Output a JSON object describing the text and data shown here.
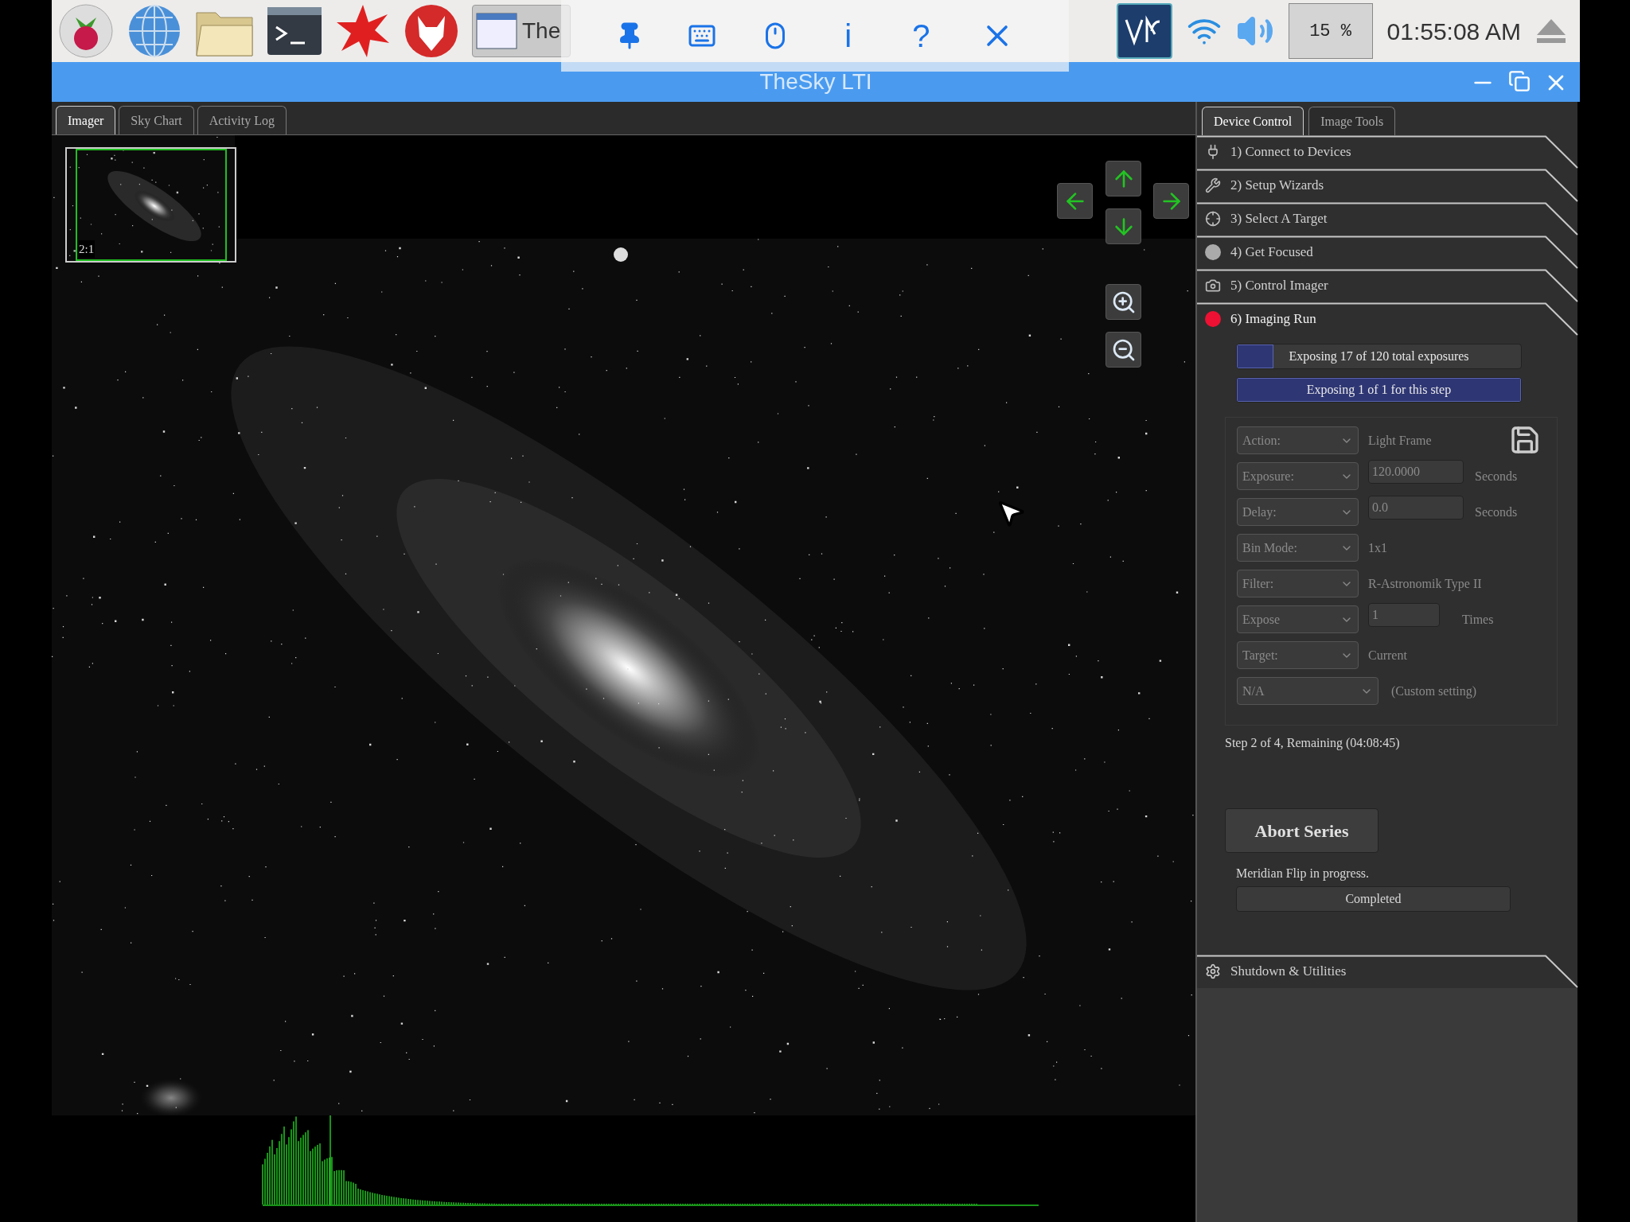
{
  "taskbar": {
    "window_button": {
      "label": "The"
    },
    "vnc_toolbar": [
      {
        "kind": "pin"
      },
      {
        "kind": "keyboard"
      },
      {
        "kind": "mouse"
      },
      {
        "kind": "text",
        "label": "i"
      },
      {
        "kind": "text",
        "label": "?"
      },
      {
        "kind": "close"
      }
    ],
    "cpu": "15 %",
    "clock": "01:55:08 AM"
  },
  "window": {
    "title": "TheSky LTI"
  },
  "imager_tabs": [
    {
      "label": "Imager",
      "selected": true
    },
    {
      "label": "Sky Chart",
      "selected": false
    },
    {
      "label": "Activity Log",
      "selected": false
    }
  ],
  "imager": {
    "thumbnail_label": "2:1"
  },
  "panel_tabs": [
    {
      "label": "Device Control",
      "selected": true
    },
    {
      "label": "Image Tools",
      "selected": false
    }
  ],
  "sections": [
    {
      "kind": "devices",
      "label": "1) Connect to Devices",
      "expanded": false
    },
    {
      "kind": "wrench",
      "label": "2) Setup Wizards",
      "expanded": false
    },
    {
      "kind": "target",
      "label": "3) Select A Target",
      "expanded": false
    },
    {
      "kind": "focus",
      "label": "4) Get Focused",
      "expanded": false
    },
    {
      "kind": "camera",
      "label": "5) Control Imager",
      "expanded": false
    },
    {
      "kind": "record",
      "label": "6) Imaging Run",
      "expanded": true
    }
  ],
  "imaging_run": {
    "progress": [
      {
        "text": "Exposing 17 of 120 total exposures",
        "level": 0.13
      },
      {
        "text": "Exposing 1 of 1 for this step",
        "level": 1
      }
    ],
    "settings": [
      {
        "kind": "value",
        "dropdown": "Action:",
        "value": "Light Frame"
      },
      {
        "kind": "field",
        "dropdown": "Exposure:",
        "field": "120.0000",
        "unit": "Seconds"
      },
      {
        "kind": "field",
        "dropdown": "Delay:",
        "field": "0.0",
        "unit": "Seconds"
      },
      {
        "kind": "value",
        "dropdown": "Bin Mode:",
        "value": "1x1"
      },
      {
        "kind": "value",
        "dropdown": "Filter:",
        "value": "R-Astronomik Type II"
      },
      {
        "kind": "short_field",
        "dropdown": "Expose",
        "field": "1",
        "unit": "Times"
      },
      {
        "kind": "value",
        "dropdown": "Target:",
        "value": "Current"
      },
      {
        "kind": "wide",
        "dropdown": "N/A",
        "value": "(Custom setting)"
      }
    ],
    "status": "Step 2 of 4, Remaining (04:08:45)",
    "abort_button": "Abort Series",
    "meridian_flip": {
      "text": "Meridian Flip in progress.",
      "state": "Completed"
    }
  },
  "utilities": {
    "kind": "gear",
    "label": "Shutdown & Utilities"
  }
}
